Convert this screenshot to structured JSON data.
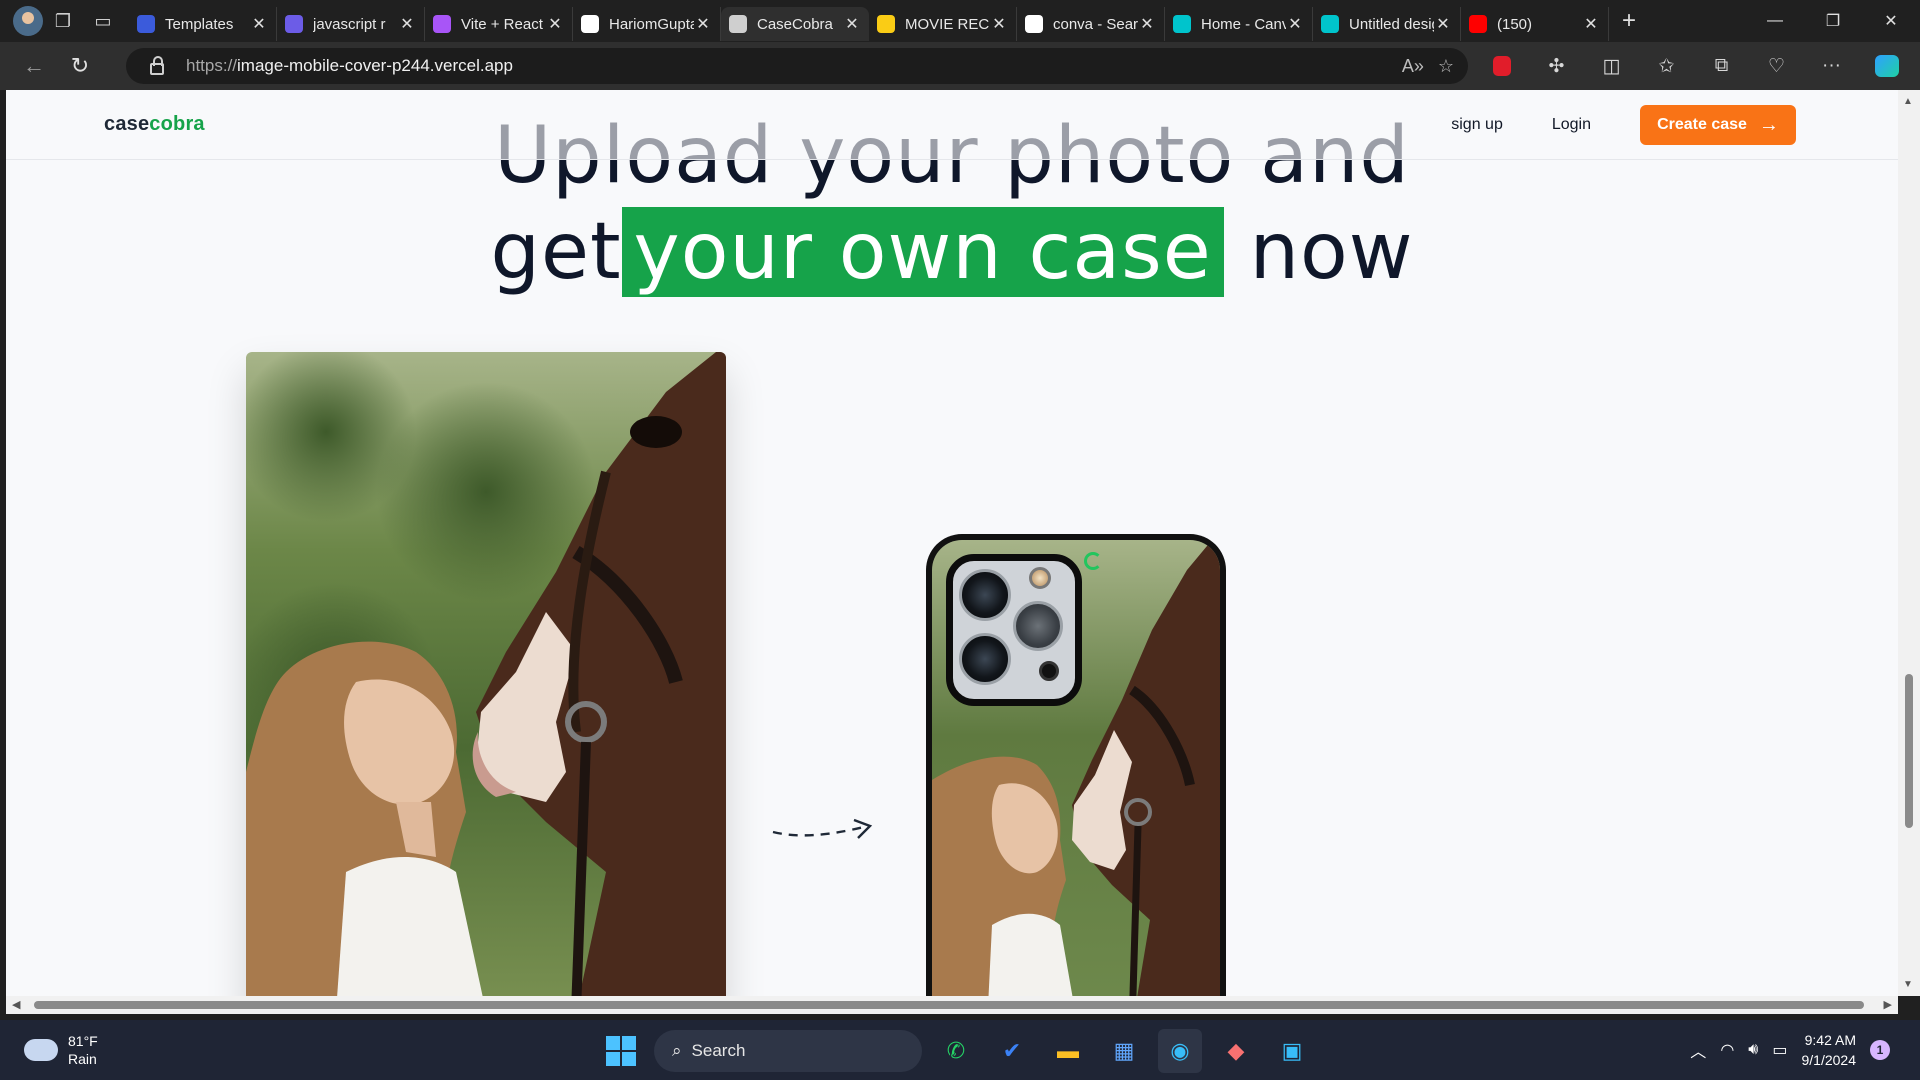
{
  "browser": {
    "tabs": [
      {
        "title": "Templates",
        "favicon_color": "#3b5bdb",
        "active": false
      },
      {
        "title": "javascript r",
        "favicon_color": "#6c5ce7",
        "active": false
      },
      {
        "title": "Vite + React",
        "favicon_color": "#a855f7",
        "active": false
      },
      {
        "title": "HariomGupta",
        "favicon_color": "#ffffff",
        "active": false
      },
      {
        "title": "CaseCobra",
        "favicon_color": "#cfcfcf",
        "active": true
      },
      {
        "title": "MOVIE REC",
        "favicon_color": "#facc15",
        "active": false
      },
      {
        "title": "conva - Search",
        "favicon_color": "#ffffff",
        "active": false
      },
      {
        "title": "Home - Canva",
        "favicon_color": "#00c4cc",
        "active": false
      },
      {
        "title": "Untitled design",
        "favicon_color": "#00c4cc",
        "active": false
      },
      {
        "title": "(150)",
        "favicon_color": "#ff0000",
        "active": false
      }
    ],
    "url_scheme": "https://",
    "url_host": "image-mobile-cover-p244.vercel.app"
  },
  "navbar": {
    "logo_part1": "case",
    "logo_part2": "cobra",
    "signup": "sign up",
    "login": "Login",
    "cta": "Create case"
  },
  "hero": {
    "line1": "Upload your photo and",
    "line2_pre": "get",
    "line2_highlight": "your own case",
    "line2_post": "now"
  },
  "taskbar": {
    "weather_temp": "81°F",
    "weather_desc": "Rain",
    "search_label": "Search",
    "time": "9:42 AM",
    "date": "9/1/2024",
    "notification_count": "1"
  },
  "colors": {
    "brand_green": "#16a34a",
    "cta_orange": "#f97316"
  }
}
